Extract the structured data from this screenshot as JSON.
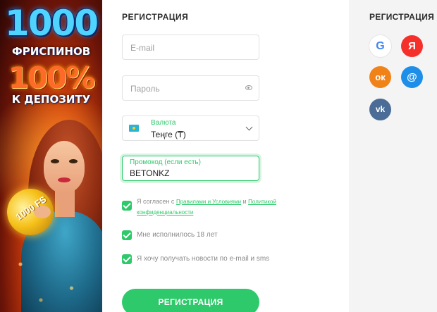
{
  "banner": {
    "line1": "1000",
    "line2": "ФРИСПИНОВ",
    "line3": "100%",
    "line4": "К ДЕПОЗИТУ",
    "coin_text": "1000 FS"
  },
  "form": {
    "title": "РЕГИСТРАЦИЯ",
    "email_placeholder": "E-mail",
    "password_placeholder": "Пароль",
    "currency_label": "Валюта",
    "currency_value": "Теңге (₸)",
    "promo_label": "Промокод (если есть)",
    "promo_value": "BETONKZ",
    "agree_prefix": "Я согласен с ",
    "agree_terms": "Правилами и Условиями",
    "agree_and": " и ",
    "agree_privacy": "Политикой конфиденциальности",
    "age_text": "Мне исполнилось 18 лет",
    "news_text": "Я хочу получать новости по e-mail и sms",
    "submit_label": "РЕГИСТРАЦИЯ"
  },
  "social": {
    "title": "РЕГИСТРАЦИЯ",
    "google": "G",
    "yandex": "Я",
    "ok": "ок",
    "mail": "@",
    "vk": "vk"
  },
  "colors": {
    "accent": "#2ec96a",
    "yandex": "#f5302b",
    "ok": "#f08218",
    "mail": "#1e8ee8",
    "vk": "#4a6c96"
  }
}
